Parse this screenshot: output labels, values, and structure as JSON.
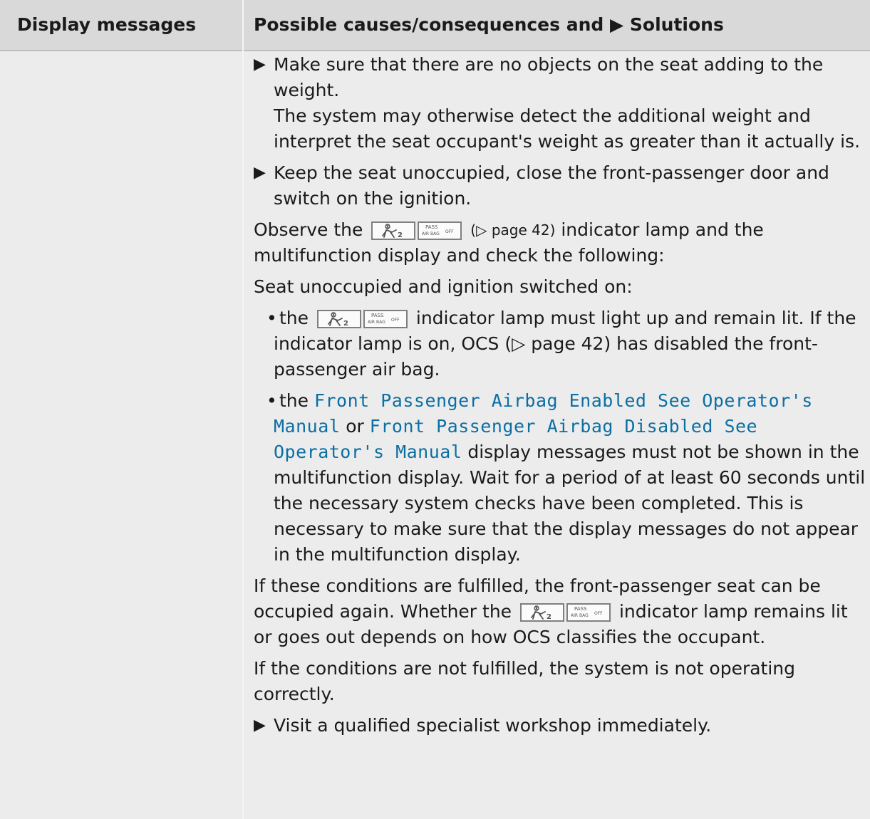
{
  "table": {
    "headers": {
      "left": "Display messages",
      "right": "Possible causes/consequences and ▶ Solutions"
    },
    "right_content": {
      "step_1_prefix": "▶",
      "step_1_text": "Make sure that there are no objects on the seat adding to the weight.",
      "step_1_followup": "The system may otherwise detect the additional weight and interpret the seat occupant's weight as greater than it actually is.",
      "step_2_prefix": "▶",
      "step_2_text": "Keep the seat unoccupied, close the front-passenger door and switch on the ignition.",
      "observe_before": "Observe the",
      "observe_ref": "(▷ page 42)",
      "observe_after": "indicator lamp and the multifunction display and check the following:",
      "seat_unoccupied": "Seat unoccupied and ignition switched on:",
      "bullet_1_before": "the",
      "bullet_1_after": "indicator lamp must light up and remain lit. If the indicator lamp is on, OCS (▷ page 42) has disabled the front-passenger air bag.",
      "bullet_2_before": "the",
      "bullet_2_msg_1": "Front Passenger Airbag Enabled See Operator's Manual",
      "bullet_2_or": "or",
      "bullet_2_msg_2": "Front Passenger Airbag Disabled See Operator's Manual",
      "bullet_2_after": "display messages must not be shown in the multifunction display. Wait for a period of at least 60 seconds until the necessary system checks have been completed. This is necessary to make sure that the display messages do not appear in the multifunction display.",
      "conditions_before": "If these conditions are fulfilled, the front-passenger seat can be occupied again. Whether the",
      "conditions_after": "indicator lamp remains lit or goes out depends on how OCS classifies the occupant.",
      "conditions_not_fulfilled": "If the conditions are not fulfilled, the system is not operating correctly.",
      "step_3_prefix": "▶",
      "step_3_text": "Visit a qualified specialist workshop immediately."
    },
    "icon_text": {
      "pass_top": "PASS",
      "pass_bottom": "AIR BAG",
      "pass_off": "OFF"
    }
  },
  "colors": {
    "header_bg": "#d9d9d9",
    "body_bg": "#ececec",
    "message_blue": "#0b6fa3"
  },
  "icons": {
    "step_marker": "triangle-right-icon",
    "occupant_lamp": "child-seat-warning-icon",
    "passenger_airbag_off": "passenger-airbag-off-icon",
    "bullet": "bullet-icon"
  }
}
